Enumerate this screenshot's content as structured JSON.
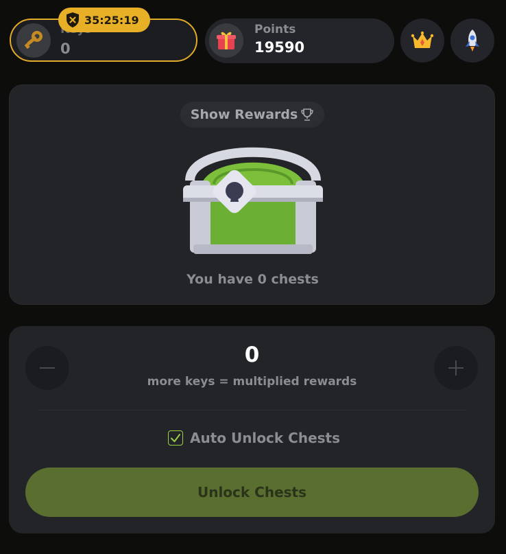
{
  "header": {
    "keys": {
      "label": "Keys",
      "value": "0",
      "timer": "35:25:19"
    },
    "points": {
      "label": "Points",
      "value": "19590"
    },
    "icons": [
      "key-icon",
      "gift-icon",
      "crown-icon",
      "rocket-icon",
      "shield-x-icon"
    ]
  },
  "chest_panel": {
    "show_rewards_label": "Show Rewards",
    "chest_count_text": "You have 0 chests"
  },
  "controls": {
    "key_count": "0",
    "multiplier_note": "more keys = multiplied rewards",
    "auto_unlock_label": "Auto Unlock Chests",
    "auto_unlock_checked": true,
    "unlock_button_label": "Unlock Chests"
  },
  "colors": {
    "background": "#0d0e0b",
    "card": "#232428",
    "accent_gold": "#e8b027",
    "accent_green": "#5a6e30",
    "check_green": "#9ed146"
  }
}
